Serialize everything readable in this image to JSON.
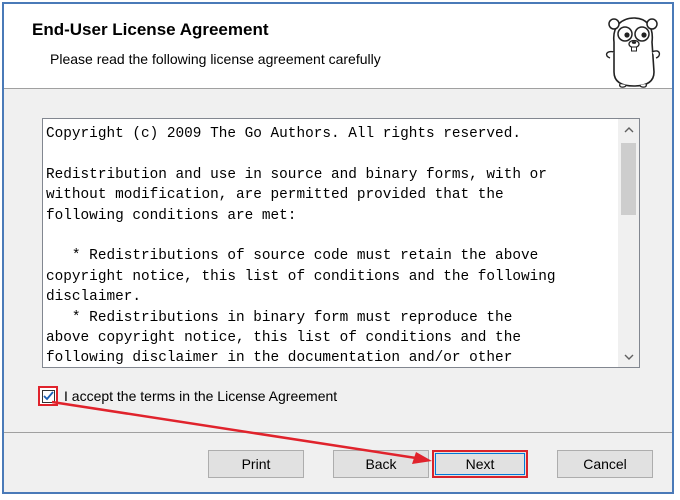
{
  "header": {
    "title": "End-User License Agreement",
    "subtitle": "Please read the following license agreement carefully"
  },
  "license": {
    "text": "Copyright (c) 2009 The Go Authors. All rights reserved.\n\nRedistribution and use in source and binary forms, with or\nwithout modification, are permitted provided that the\nfollowing conditions are met:\n\n   * Redistributions of source code must retain the above\ncopyright notice, this list of conditions and the following\ndisclaimer.\n   * Redistributions in binary form must reproduce the\nabove copyright notice, this list of conditions and the\nfollowing disclaimer in the documentation and/or other"
  },
  "accept": {
    "label": "I accept the terms in the License Agreement",
    "checked": true
  },
  "buttons": {
    "print": "Print",
    "back": "Back",
    "next": "Next",
    "cancel": "Cancel"
  },
  "colors": {
    "highlight": "#e0232c",
    "frame": "#4a7ab8"
  },
  "icons": {
    "logo": "go-gopher-icon",
    "scroll_up": "chevron-up-icon",
    "scroll_down": "chevron-down-icon",
    "check": "checkmark-icon"
  }
}
